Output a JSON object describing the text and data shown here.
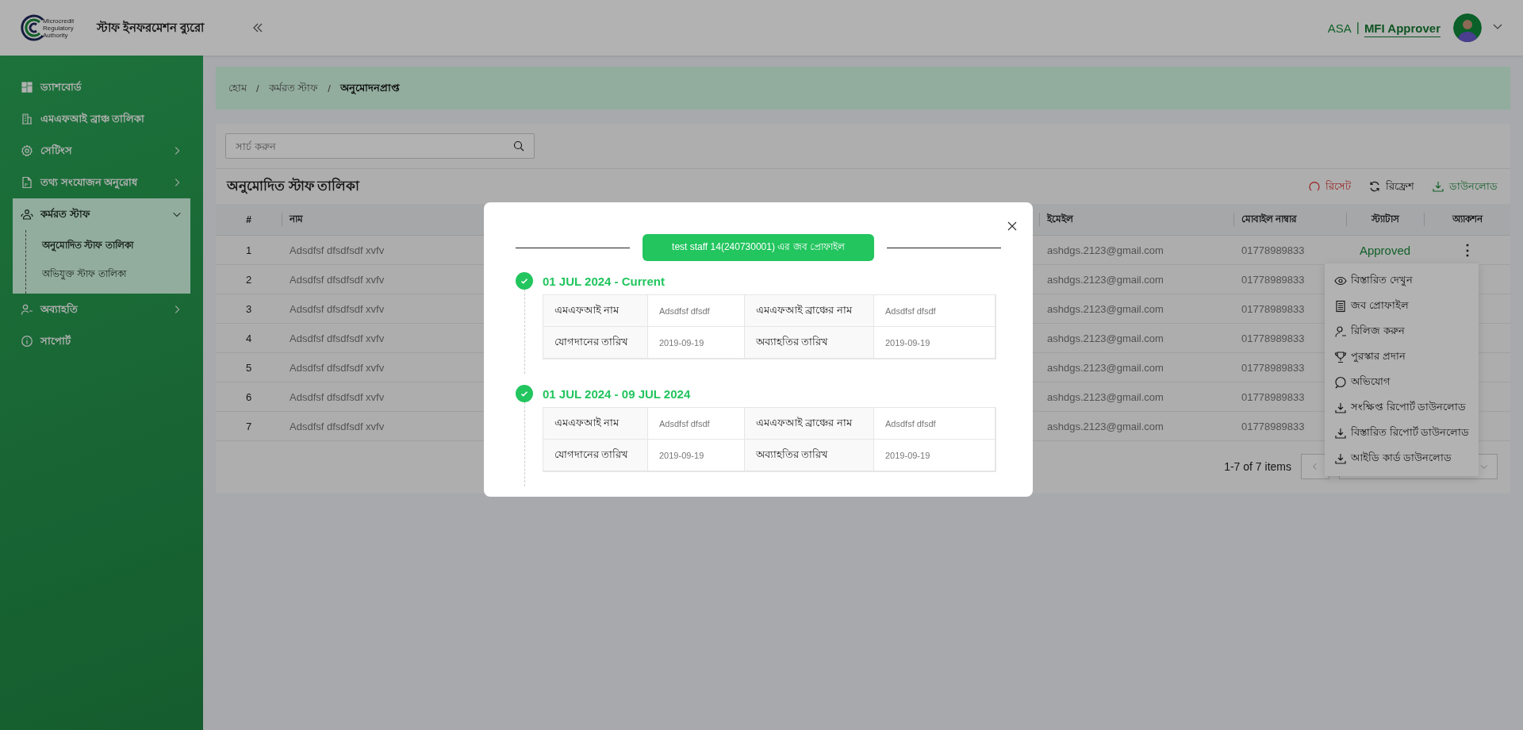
{
  "header": {
    "logo_text": "Microcredit Regulatory Authority",
    "title": "স্টাফ ইনফরমেশন ব্যুরো",
    "org": "ASA",
    "separator": "|",
    "role": "MFI Approver"
  },
  "sidebar": {
    "items": [
      {
        "label": "ড্যাশবোর্ড"
      },
      {
        "label": "এমএফআই ব্রাঞ্চ তালিকা"
      },
      {
        "label": "সেটিংস",
        "expanded": false
      },
      {
        "label": "তথ্য সংযোজন অনুরোধ",
        "expanded": false
      },
      {
        "label": "কর্মরত স্টাফ",
        "expanded": true,
        "children": [
          {
            "label": "অনুমোদিত স্টাফ তালিকা",
            "selected": true
          },
          {
            "label": "অভিযুক্ত স্টাফ তালিকা",
            "selected": false
          }
        ]
      },
      {
        "label": "অব্যাহতি",
        "expanded": false
      },
      {
        "label": "সাপোর্ট"
      }
    ]
  },
  "breadcrumb": {
    "separator": "/",
    "items": [
      "হোম",
      "কর্মরত স্টাফ",
      "অনুমোদনপ্রাপ্ত"
    ]
  },
  "search": {
    "placeholder": "সার্চ করুন"
  },
  "table": {
    "title": "অনুমোদিত স্টাফ তালিকা",
    "actions": [
      {
        "label": "রিসেট",
        "kind": "reset"
      },
      {
        "label": "রিফ্রেশ",
        "kind": "refresh"
      },
      {
        "label": "ডাউনলোড",
        "kind": "download"
      }
    ],
    "columns": [
      "#",
      "নাম",
      "ইমেইল",
      "মোবাইল নাম্বার",
      "স্ট্যাটাস",
      "অ্যাকশন"
    ],
    "rows": [
      {
        "number": "1",
        "name": "Adsdfsf dfsdfsdf xvfv",
        "email": "ashdgs.2123@gmail.com",
        "mobile": "01778989833",
        "status": "Approved",
        "action": "⋮"
      },
      {
        "number": "2",
        "name": "Adsdfsf dfsdfsdf xvfv",
        "email": "ashdgs.2123@gmail.com",
        "mobile": "01778989833"
      },
      {
        "number": "3",
        "name": "Adsdfsf dfsdfsdf xvfv",
        "email": "ashdgs.2123@gmail.com",
        "mobile": "01778989833"
      },
      {
        "number": "4",
        "name": "Adsdfsf dfsdfsdf xvfv",
        "email": "ashdgs.2123@gmail.com",
        "mobile": "01778989833"
      },
      {
        "number": "5",
        "name": "Adsdfsf dfsdfsdf xvfv",
        "email": "ashdgs.2123@gmail.com",
        "mobile": "01778989833"
      },
      {
        "number": "6",
        "name": "Adsdfsf dfsdfsdf xvfv",
        "email": "ashdgs.2123@gmail.com",
        "mobile": "01778989833"
      },
      {
        "number": "7",
        "name": "Adsdfsf dfsdfsdf xvfv",
        "email": "ashdgs.2123@gmail.com",
        "mobile": "01778989833"
      }
    ],
    "pagination": {
      "summary": "1-7 of 7 items"
    }
  },
  "row_menu": {
    "items": [
      {
        "label": "বিস্তারিত দেখুন",
        "kind": "view"
      },
      {
        "label": "জব প্রোফাইল",
        "kind": "profile"
      },
      {
        "label": "রিলিজ করুন",
        "kind": "release"
      },
      {
        "label": "পুরস্কার প্রদান",
        "kind": "award"
      },
      {
        "label": "অভিযোগ",
        "kind": "complaint"
      },
      {
        "label": "সংক্ষিপ্ত রিপোর্ট ডাউনলোড",
        "kind": "download"
      },
      {
        "label": "বিস্তারিত রিপোর্ট ডাউনলোড",
        "kind": "download"
      },
      {
        "label": "আইডি কার্ড ডাউনলোড",
        "kind": "download"
      }
    ]
  },
  "modal": {
    "heading": "test staff 14(240730001) এর জব প্রোফাইল",
    "periods": [
      {
        "title": "01 JUL 2024 - Current",
        "fields": [
          {
            "label": "এমএফআই নাম",
            "value": "Adsdfsf dfsdf"
          },
          {
            "label": "এমএফআই ব্রাঞ্চের নাম",
            "value": "Adsdfsf dfsdf"
          },
          {
            "label": "যোগদানের তারিখ",
            "value": "2019-09-19"
          },
          {
            "label": "অব্যাহতির তারিখ",
            "value": "2019-09-19"
          }
        ]
      },
      {
        "title": "01 JUL 2024 - 09 JUL 2024",
        "fields": [
          {
            "label": "এমএফআই নাম",
            "value": "Adsdfsf dfsdf"
          },
          {
            "label": "এমএফআই ব্রাঞ্চের নাম",
            "value": "Adsdfsf dfsdf"
          },
          {
            "label": "যোগদানের তারিখ",
            "value": "2019-09-19"
          },
          {
            "label": "অব্যাহতির তারিখ",
            "value": "2019-09-19"
          }
        ]
      }
    ]
  }
}
